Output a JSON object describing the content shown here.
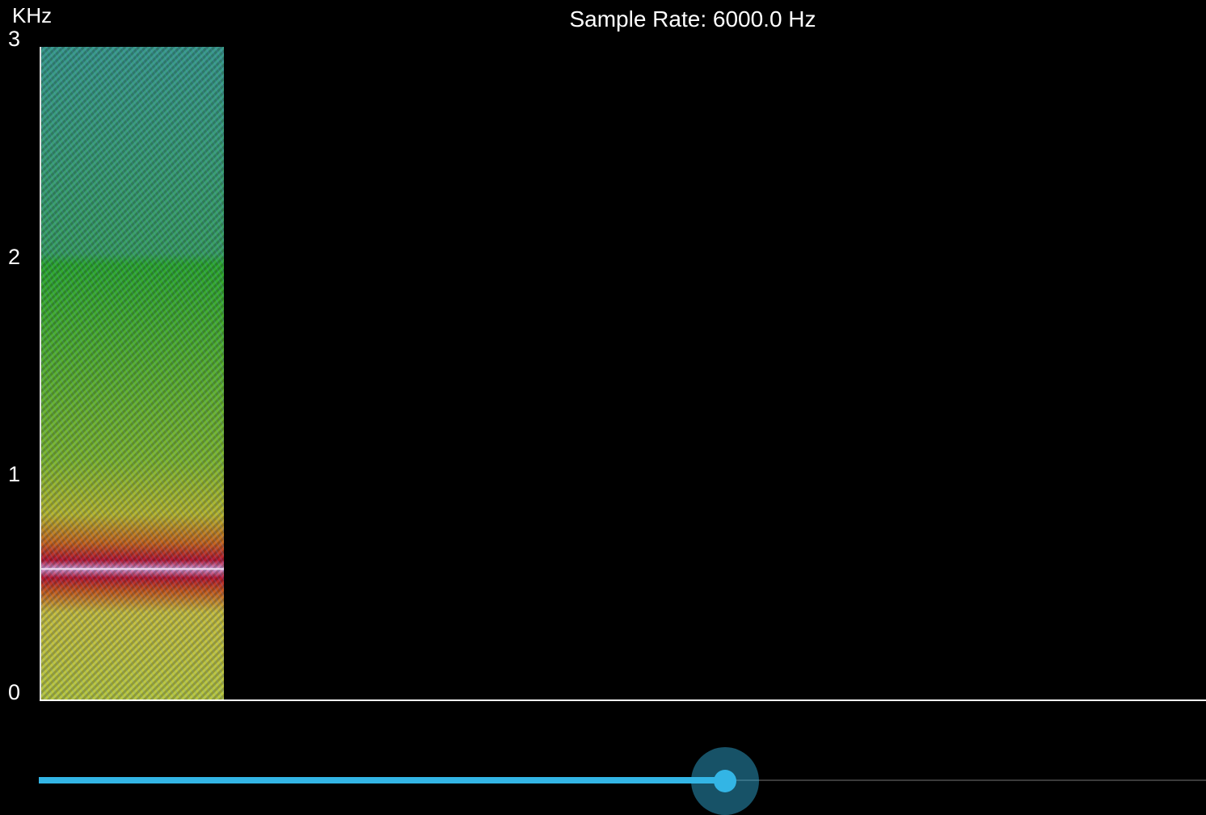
{
  "header": {
    "unit_label": "KHz",
    "sample_rate_text": "Sample Rate: 6000.0 Hz"
  },
  "colors": {
    "background": "#000000",
    "axis": "#ffffff",
    "slider_accent": "#33b5e5"
  },
  "chart_data": {
    "type": "heatmap",
    "title": "Sample Rate: 6000.0 Hz",
    "ylabel": "KHz",
    "xlabel": "",
    "ylim": [
      0,
      3
    ],
    "y_ticks": [
      "0",
      "1",
      "2",
      "3"
    ],
    "grid": false,
    "colormap_stops": [
      {
        "khz": 0.0,
        "color": "#b8c840"
      },
      {
        "khz": 0.4,
        "color": "#c8c040"
      },
      {
        "khz": 0.5,
        "color": "#c85a1e"
      },
      {
        "khz": 0.56,
        "color": "#b81830"
      },
      {
        "khz": 0.6,
        "color": "#d8a0d8"
      },
      {
        "khz": 0.64,
        "color": "#b81830"
      },
      {
        "khz": 0.72,
        "color": "#c8681e"
      },
      {
        "khz": 0.85,
        "color": "#b8b830"
      },
      {
        "khz": 1.1,
        "color": "#80b830"
      },
      {
        "khz": 2.0,
        "color": "#2ea82e"
      },
      {
        "khz": 2.05,
        "color": "#3aa060"
      },
      {
        "khz": 3.0,
        "color": "#3a9a88"
      }
    ],
    "peak_frequency_khz": 0.6,
    "filled_time_fraction": 0.157
  },
  "slider": {
    "value_fraction": 0.588
  }
}
